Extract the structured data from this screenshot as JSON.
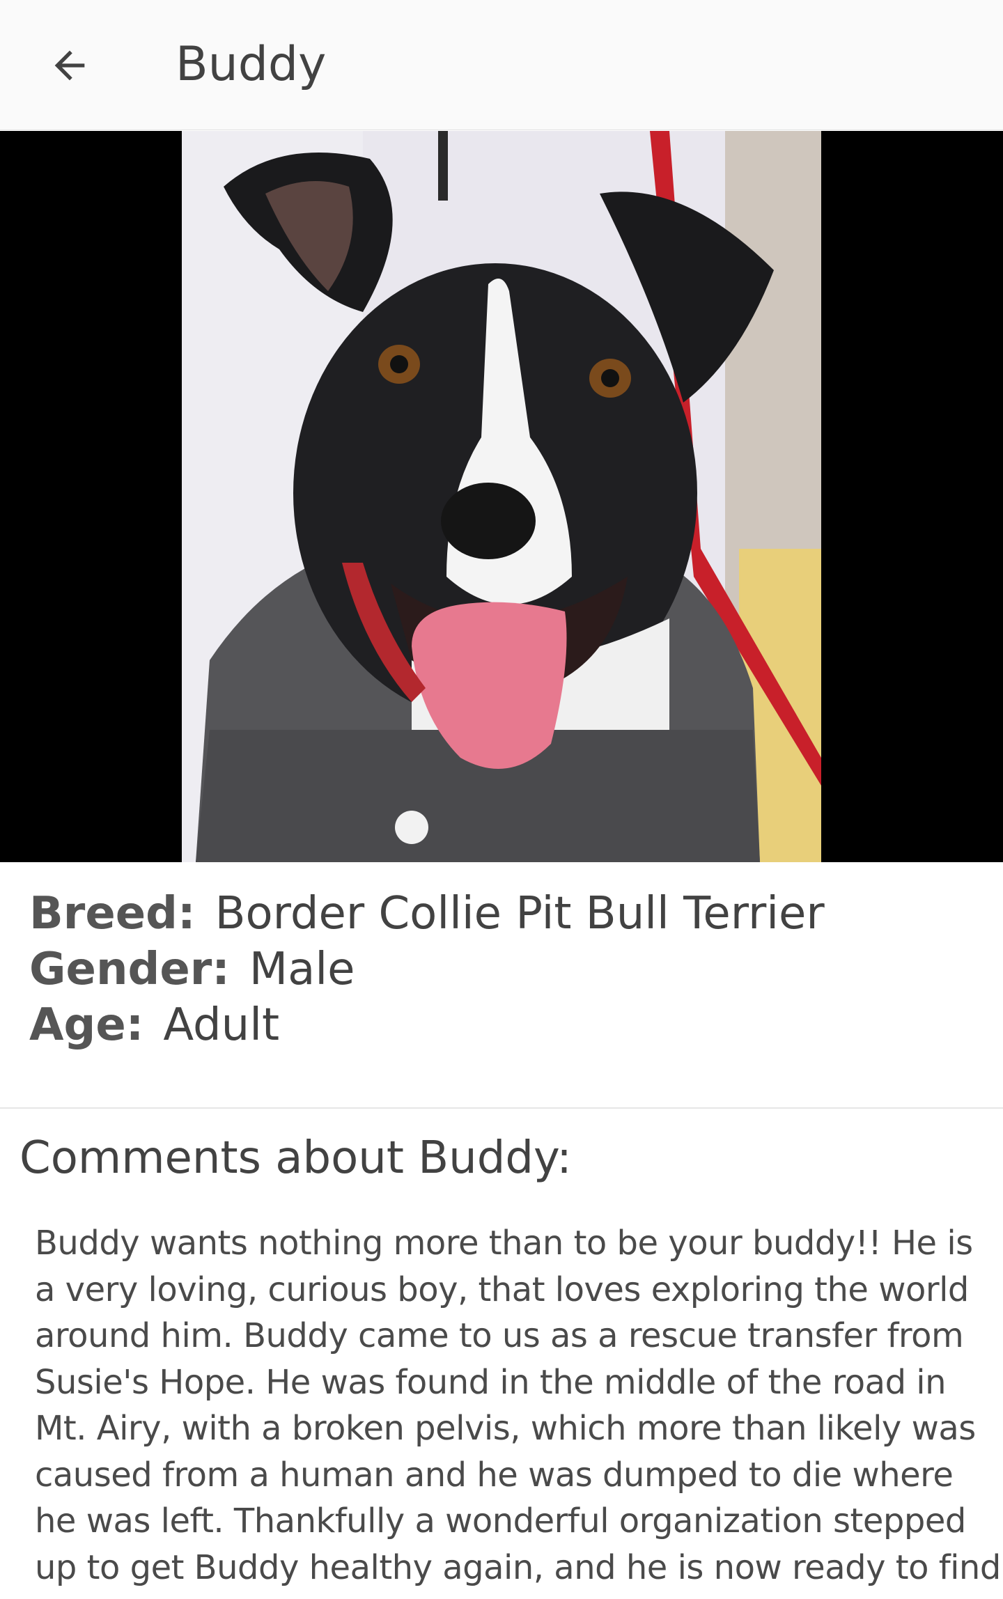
{
  "app_bar": {
    "title": "Buddy"
  },
  "photo": {
    "alt": "Buddy"
  },
  "details": {
    "breed_label": "Breed:",
    "breed_value": "Border Collie Pit Bull Terrier",
    "gender_label": "Gender:",
    "gender_value": "Male",
    "age_label": "Age:",
    "age_value": "Adult"
  },
  "comments": {
    "title": "Comments about Buddy:",
    "lines": [
      "Buddy wants nothing more than to be your buddy!!  He is",
      "a very loving, curious boy, that loves exploring the world",
      "around him.  Buddy came to us as a rescue transfer from",
      "Susie's Hope.  He was found in the middle of the road in",
      "Mt. Airy, with a broken pelvis, which more than likely was",
      "caused from a human and he was dumped to die where",
      "he was left.  Thankfully a wonderful organization stepped",
      "up to get Buddy healthy again, and he is now ready to find"
    ]
  },
  "icons": {
    "back": "arrow-back-icon"
  }
}
